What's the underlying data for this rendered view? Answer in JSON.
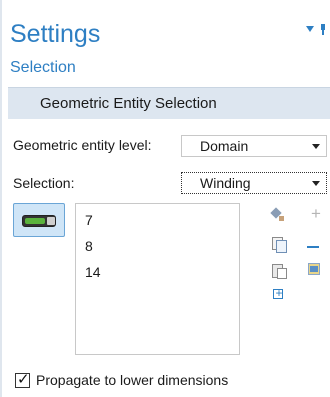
{
  "header": {
    "title": "Settings",
    "subtitle": "Selection",
    "accent_color": "#2e7fc3"
  },
  "section": {
    "title": "Geometric Entity Selection"
  },
  "fields": {
    "entity_level_label": "Geometric entity level:",
    "entity_level_value": "Domain",
    "selection_label": "Selection:",
    "selection_value": "Winding"
  },
  "selection_list": {
    "items": [
      "7",
      "8",
      "14"
    ]
  },
  "toolbar": {
    "icons": [
      "paint-icon",
      "copy-icon",
      "paste-icon",
      "zoom-to-selection-icon",
      "add-icon",
      "remove-icon",
      "clear-selection-icon"
    ]
  },
  "options": {
    "propagate_label": "Propagate to lower dimensions",
    "propagate_checked": true
  }
}
